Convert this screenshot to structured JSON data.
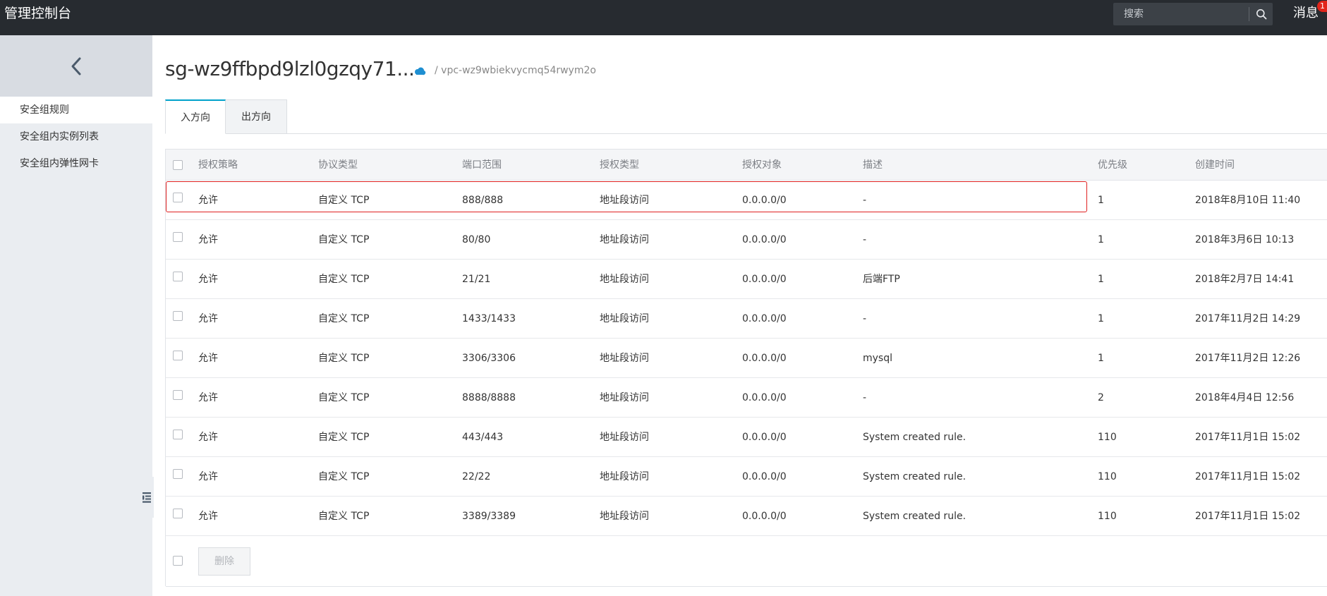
{
  "header": {
    "brand": "管理控制台",
    "search_placeholder": "搜索",
    "messages_label": "消息",
    "messages_badge": "1"
  },
  "sidebar": {
    "items": [
      {
        "label": "安全组规则",
        "active": true
      },
      {
        "label": "安全组内实例列表",
        "active": false
      },
      {
        "label": "安全组内弹性网卡",
        "active": false
      }
    ]
  },
  "page": {
    "title": "sg-wz9ffbpd9lzl0gzqy71...",
    "breadcrumb": "/ vpc-wz9wbiekvycmq54rwym2o"
  },
  "tabs": [
    {
      "label": "入方向",
      "active": true
    },
    {
      "label": "出方向",
      "active": false
    }
  ],
  "table": {
    "columns": [
      "授权策略",
      "协议类型",
      "端口范围",
      "授权类型",
      "授权对象",
      "描述",
      "优先级",
      "创建时间"
    ],
    "rows": [
      [
        "允许",
        "自定义 TCP",
        "888/888",
        "地址段访问",
        "0.0.0.0/0",
        "-",
        "1",
        "2018年8月10日 11:40"
      ],
      [
        "允许",
        "自定义 TCP",
        "80/80",
        "地址段访问",
        "0.0.0.0/0",
        "-",
        "1",
        "2018年3月6日 10:13"
      ],
      [
        "允许",
        "自定义 TCP",
        "21/21",
        "地址段访问",
        "0.0.0.0/0",
        "后端FTP",
        "1",
        "2018年2月7日 14:41"
      ],
      [
        "允许",
        "自定义 TCP",
        "1433/1433",
        "地址段访问",
        "0.0.0.0/0",
        "-",
        "1",
        "2017年11月2日 14:29"
      ],
      [
        "允许",
        "自定义 TCP",
        "3306/3306",
        "地址段访问",
        "0.0.0.0/0",
        "mysql",
        "1",
        "2017年11月2日 12:26"
      ],
      [
        "允许",
        "自定义 TCP",
        "8888/8888",
        "地址段访问",
        "0.0.0.0/0",
        "-",
        "2",
        "2018年4月4日 12:56"
      ],
      [
        "允许",
        "自定义 TCP",
        "443/443",
        "地址段访问",
        "0.0.0.0/0",
        "System created rule.",
        "110",
        "2017年11月1日 15:02"
      ],
      [
        "允许",
        "自定义 TCP",
        "22/22",
        "地址段访问",
        "0.0.0.0/0",
        "System created rule.",
        "110",
        "2017年11月1日 15:02"
      ],
      [
        "允许",
        "自定义 TCP",
        "3389/3389",
        "地址段访问",
        "0.0.0.0/0",
        "System created rule.",
        "110",
        "2017年11月1日 15:02"
      ]
    ],
    "highlighted_row": 0,
    "delete_label": "删除"
  },
  "colors": {
    "topbar": "#272b30",
    "tab_accent": "#00a2ca",
    "highlight": "#e02020",
    "badge": "#e1251b"
  },
  "icons": [
    "search-icon",
    "chevron-left-icon",
    "cloud-icon",
    "collapse-sidebar-icon"
  ]
}
